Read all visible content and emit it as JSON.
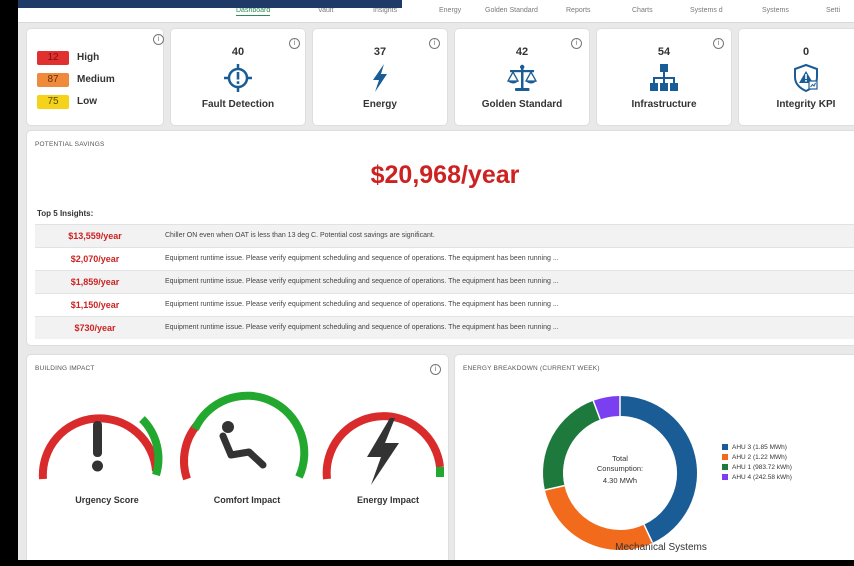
{
  "nav": {
    "items": [
      "Dashboard",
      "Vault",
      "Insights",
      "Energy",
      "Golden Standard",
      "Reports",
      "Charts",
      "Systems d",
      "Systems",
      "Setti"
    ]
  },
  "severity": {
    "high": {
      "count": "12",
      "label": "High",
      "color": "#e03030"
    },
    "medium": {
      "count": "87",
      "label": "Medium",
      "color": "#ef8a3c"
    },
    "low": {
      "count": "75",
      "label": "Low",
      "color": "#f5d31a"
    }
  },
  "kpis": [
    {
      "count": "40",
      "label": "Fault Detection",
      "icon": "crosshair-alert-icon"
    },
    {
      "count": "37",
      "label": "Energy",
      "icon": "lightning-icon"
    },
    {
      "count": "42",
      "label": "Golden Standard",
      "icon": "scales-icon"
    },
    {
      "count": "54",
      "label": "Infrastructure",
      "icon": "hierarchy-icon"
    },
    {
      "count": "0",
      "label": "Integrity KPI",
      "icon": "shield-alert-icon"
    }
  ],
  "savings": {
    "title": "POTENTIAL SAVINGS",
    "total": "$20,968/year",
    "top5_label": "Top 5 Insights:",
    "insights": [
      {
        "amount": "$13,559/year",
        "text": "Chiller ON even when OAT is less than 13 deg C. Potential cost savings are significant."
      },
      {
        "amount": "$2,070/year",
        "text": "Equipment runtime issue. Please verify equipment scheduling and sequence of operations. The equipment has been running ..."
      },
      {
        "amount": "$1,859/year",
        "text": "Equipment runtime issue. Please verify equipment scheduling and sequence of operations. The equipment has been running ..."
      },
      {
        "amount": "$1,150/year",
        "text": "Equipment runtime issue. Please verify equipment scheduling and sequence of operations. The equipment has been running ..."
      },
      {
        "amount": "$730/year",
        "text": "Equipment runtime issue. Please verify equipment scheduling and sequence of operations. The equipment has been running ..."
      }
    ]
  },
  "building_impact": {
    "title": "BUILDING IMPACT",
    "gauges": [
      {
        "label": "Urgency Score",
        "icon": "exclamation-icon"
      },
      {
        "label": "Comfort Impact",
        "icon": "reclining-person-icon"
      },
      {
        "label": "Energy Impact",
        "icon": "lightning-icon"
      }
    ]
  },
  "energy": {
    "title": "ENERGY BREAKDOWN (CURRENT WEEK)",
    "center_line1": "Total",
    "center_line2": "Consumption:",
    "center_value": "4.30 MWh",
    "footer": "Mechanical Systems",
    "legend": [
      {
        "label": "AHU 3 (1.85 MWh)",
        "value": 1.85,
        "color": "#1a5c96"
      },
      {
        "label": "AHU 2 (1.22 MWh)",
        "value": 1.22,
        "color": "#f26b1d"
      },
      {
        "label": "AHU 1 (983.72 kWh)",
        "value": 0.98372,
        "color": "#1e7a3c"
      },
      {
        "label": "AHU 4 (242.58 kWh)",
        "value": 0.24258,
        "color": "#7b3ff2"
      }
    ]
  },
  "colors": {
    "red": "#d92b2b",
    "green": "#22a82e",
    "savings_red": "#cc2222"
  }
}
